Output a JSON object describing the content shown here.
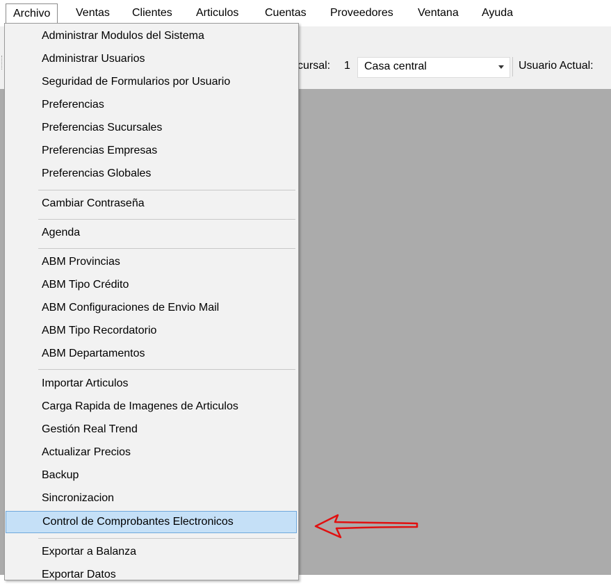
{
  "menubar": {
    "items": [
      "Archivo",
      "Ventas",
      "Clientes",
      "Articulos",
      "Cuentas",
      "Proveedores",
      "Ventana",
      "Ayuda"
    ]
  },
  "toolbar": {
    "sucursal_label": "cursal:",
    "sucursal_number": "1",
    "sucursal_value": "Casa central",
    "usuario_label": "Usuario Actual:"
  },
  "archivo_menu": {
    "items": [
      "Administrar Modulos del Sistema",
      "Administrar Usuarios",
      "Seguridad de Formularios por Usuario",
      "Preferencias",
      "Preferencias Sucursales",
      "Preferencias Empresas",
      "Preferencias Globales",
      "Cambiar Contraseña",
      "Agenda",
      "ABM Provincias",
      "ABM Tipo Crédito",
      "ABM Configuraciones de Envio Mail",
      "ABM Tipo Recordatorio",
      "ABM Departamentos",
      "Importar Articulos",
      "Carga Rapida de Imagenes de Articulos",
      "Gestión Real Trend",
      "Actualizar Precios",
      "Backup",
      "Sincronizacion",
      "Control de Comprobantes Electronicos",
      "Exportar a Balanza",
      "Exportar Datos"
    ],
    "highlighted": "Control de Comprobantes Electronicos"
  },
  "colors": {
    "highlight_bg": "#c5e0f7",
    "highlight_border": "#6fa8dc",
    "annotation_arrow": "#e01010",
    "workspace": "#ababab"
  }
}
